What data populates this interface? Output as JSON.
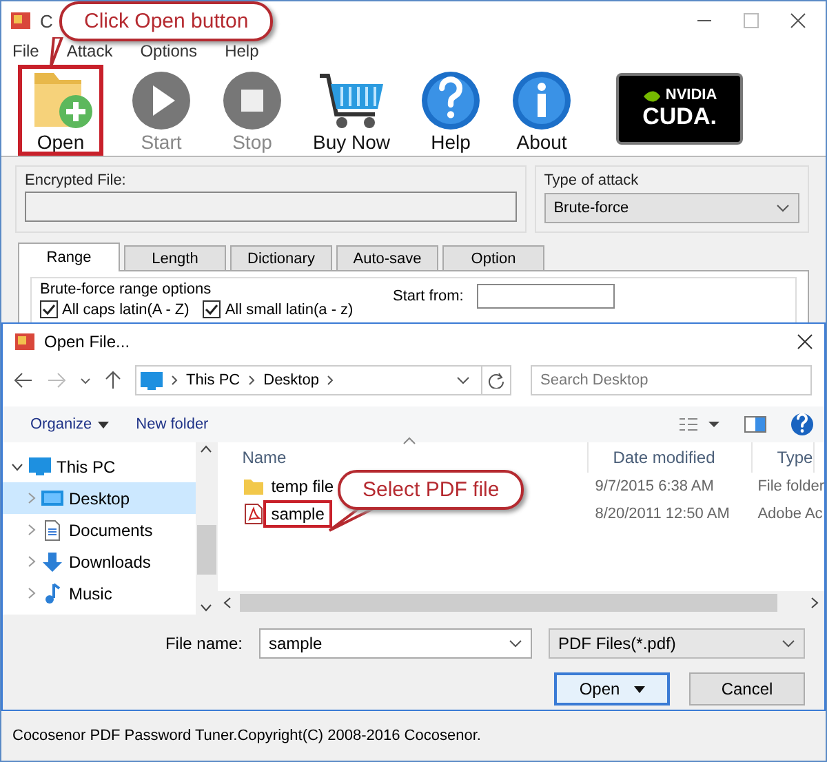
{
  "window": {
    "title": "C"
  },
  "menu": [
    "File",
    "Attack",
    "Options",
    "Help"
  ],
  "toolbar": [
    {
      "label": "Open",
      "disabled": false
    },
    {
      "label": "Start",
      "disabled": true
    },
    {
      "label": "Stop",
      "disabled": true
    },
    {
      "label": "Buy Now",
      "disabled": false
    },
    {
      "label": "Help",
      "disabled": false
    },
    {
      "label": "About",
      "disabled": false
    }
  ],
  "logo": {
    "line1": "NVIDIA",
    "line2": "CUDA."
  },
  "encrypted_file": {
    "label": "Encrypted File:"
  },
  "attack_type": {
    "label": "Type of attack",
    "value": "Brute-force"
  },
  "tabs": [
    {
      "label": "Range",
      "selected": true
    },
    {
      "label": "Length",
      "selected": false
    },
    {
      "label": "Dictionary",
      "selected": false
    },
    {
      "label": "Auto-save",
      "selected": false
    },
    {
      "label": "Option",
      "selected": false
    }
  ],
  "range_group": {
    "title": "Brute-force range options",
    "options": [
      {
        "label": "All caps latin(A - Z)",
        "checked": true
      },
      {
        "label": "All small latin(a - z)",
        "checked": true
      }
    ],
    "start_from": {
      "label": "Start from:"
    }
  },
  "dialog": {
    "title": "Open File...",
    "breadcrumb": [
      "This PC",
      "Desktop"
    ],
    "search": {
      "placeholder": "Search Desktop"
    },
    "toolbar": [
      {
        "label": "Organize",
        "kind": "menu"
      },
      {
        "label": "New folder",
        "kind": "plain"
      }
    ],
    "nav": [
      {
        "label": "This PC",
        "expanded": true,
        "selected": false,
        "children": [
          {
            "label": "Desktop",
            "expanded": false,
            "selected": true
          },
          {
            "label": "Documents",
            "expanded": false,
            "selected": false
          },
          {
            "label": "Downloads",
            "expanded": false,
            "selected": false
          },
          {
            "label": "Music",
            "expanded": false,
            "selected": false
          }
        ]
      }
    ],
    "columns": [
      "Name",
      "Date modified",
      "Type"
    ],
    "files": [
      {
        "name": "temp file",
        "date": "9/7/2015 6:38 AM",
        "type": "File folder",
        "kind": "folder"
      },
      {
        "name": "sample",
        "date": "8/20/2011 12:50 AM",
        "type": "Adobe Ac",
        "kind": "pdf"
      }
    ],
    "file_name": {
      "label": "File name:",
      "value": "sample"
    },
    "filter": "PDF Files(*.pdf)",
    "buttons": [
      {
        "label": "Open",
        "kind": "split"
      },
      {
        "label": "Cancel",
        "kind": "plain"
      }
    ]
  },
  "status_bar": "Cocosenor PDF Password Tuner.Copyright(C) 2008-2016 Cocosenor.",
  "callouts": [
    {
      "text": "Click Open button"
    },
    {
      "text": "Select PDF file"
    }
  ]
}
